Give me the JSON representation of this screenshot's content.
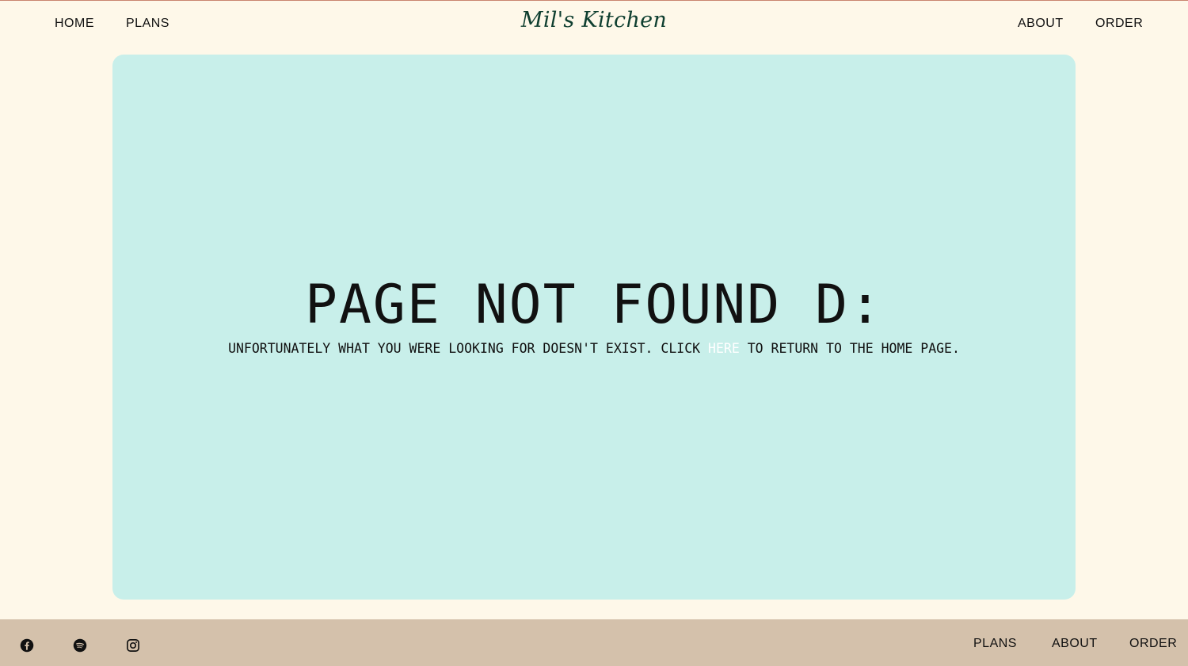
{
  "brand": {
    "name": "Mil's Kitchen"
  },
  "header": {
    "nav_left": [
      "HOME",
      "PLANS"
    ],
    "nav_right": [
      "ABOUT",
      "ORDER"
    ]
  },
  "main": {
    "title": "PAGE NOT FOUND D:",
    "message_before": "UNFORTUNATELY WHAT YOU WERE LOOKING FOR DOESN'T EXIST. CLICK ",
    "link_text": "HERE",
    "message_after": " TO RETURN TO THE HOME PAGE."
  },
  "footer": {
    "social_icons": [
      "facebook-icon",
      "spotify-icon",
      "instagram-icon"
    ],
    "nav": [
      "PLANS",
      "ABOUT",
      "ORDER"
    ]
  },
  "colors": {
    "page_background": "#fef8e9",
    "card_background": "#c8efea",
    "footer_background": "#d4c1ab",
    "brand_text": "#0f3f30",
    "link_text": "#ffffff"
  }
}
